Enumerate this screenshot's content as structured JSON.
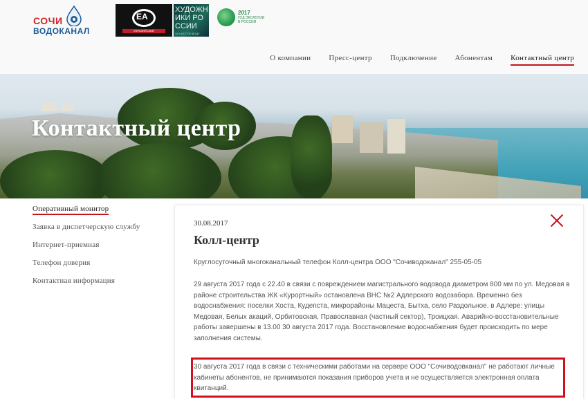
{
  "logo": {
    "word1": "СОЧИ",
    "word2": "ВОДОКАНАЛ"
  },
  "partners": {
    "eurasian": {
      "emblem": "ЕА",
      "caption": "ЕВРАЗИЙСКИЙ"
    },
    "art": {
      "text": "ХУДОЖНИКИ РОССИИ",
      "sub": "ЗА ЧИСТУЮ ВОДУ"
    },
    "eco": {
      "year": "2017",
      "text": "ГОД ЭКОЛОГИИ В РОССИИ"
    }
  },
  "nav": {
    "items": [
      {
        "label": "О компании"
      },
      {
        "label": "Пресс-центр"
      },
      {
        "label": "Подключение"
      },
      {
        "label": "Абонентам"
      },
      {
        "label": "Контактный центр"
      }
    ]
  },
  "hero": {
    "title": "Контактный центр"
  },
  "sidebar": {
    "items": [
      {
        "label": "Оперативный монитор"
      },
      {
        "label": "Заявка в диспетчерскую службу"
      },
      {
        "label": "Интернет-приемная"
      },
      {
        "label": "Телефон доверия"
      },
      {
        "label": "Контактная информация"
      }
    ]
  },
  "article": {
    "date": "30.08.2017",
    "title": "Колл-центр",
    "p1": "Круглосуточный многоканальный телефон Колл-центра ООО \"Сочиводоканал\" 255-05-05",
    "p2": "29 августа 2017 года с 22.40 в связи с повреждением магистрального водовода диаметром 800 мм по ул. Медовая в районе строительства ЖК «Курортный» остановлена ВНС №2 Адлерского водозабора. Временно без водоснабжения: поселки Хоста, Кудепста, микрорайоны Мацеста, Бытха, село Раздольное. в Адлере: улицы Медовая, Белых акаций, Орбитовская, Православная (частный сектор), Троицкая. Аварийно-восстановительные работы завершены в 13.00 30 августа 2017 года. Восстановление водоснабжения будет происходить по мере заполнения системы.",
    "p3": "30 августа 2017 года в связи с техническими работами на сервере ООО \"Сочиводовканал\" не работают личные кабинеты абонентов, не принимаются показания приборов учета и не осуществляется электронная оплата квитанций."
  },
  "colors": {
    "accent": "#c0161e",
    "highlight": "#d10f1e",
    "brand_blue": "#1a5b98"
  }
}
